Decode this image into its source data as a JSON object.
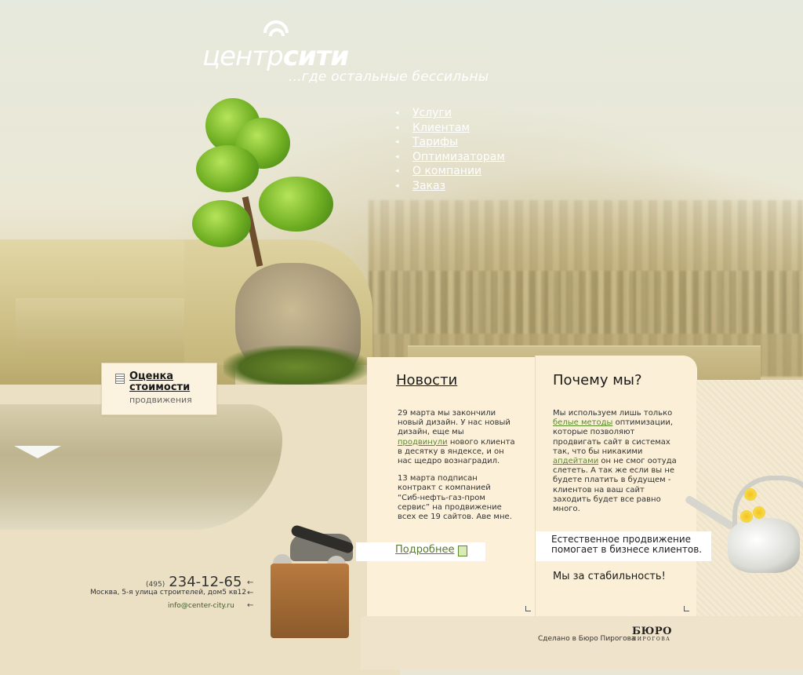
{
  "logo": {
    "part1": "центр",
    "part2": "сити",
    "tagline": "...где остальные бессильны"
  },
  "menu": [
    {
      "label": "Услуги"
    },
    {
      "label": "Клиентам"
    },
    {
      "label": "Тарифы"
    },
    {
      "label": "Оптимизаторам"
    },
    {
      "label": "О компании"
    },
    {
      "label": "Заказ"
    }
  ],
  "estimate": {
    "title": "Оценка стоимости",
    "subtitle": "продвижения"
  },
  "news": {
    "title": "Новости",
    "item1_before": "29 марта мы закончили новый дизайн. У нас новый дизайн, еще мы ",
    "item1_link": "продвинули",
    "item1_after": " нового клиента в десятку в яндексе, и он нас щедро вознаградил.",
    "item2": "13 марта подписан контракт с компанией “Сиб-нефть-газ-пром сервис” на продвижение всех ее 19 сайтов. Аве мне.",
    "more": "Подробнее"
  },
  "why": {
    "title": "Почему мы?",
    "text_before": "Мы используем лишь только ",
    "link1": "белые методы",
    "text_mid1": " оптимизации, которые позволяют продвигать сайт в системах так, что бы никакими ",
    "link2": "апдейтами",
    "text_mid2": " он не смог оотуда слететь. А так же если вы не будете платить в будущем - клиентов на ваш сайт заходить будет все равно много.",
    "banner": "Естественное продвижение помогает в бизнесе клиентов.",
    "stability": "Мы за стабильность!"
  },
  "contact": {
    "phone_code": "(495)",
    "phone": "234-12-65",
    "address": "Москва, 5-я улица строителей, дом5 кв12",
    "email": "info@center-city.ru"
  },
  "footer": {
    "credit": "Сделано в Бюро Пирогова",
    "bureau_big": "БЮРО",
    "bureau_small": "ПИРОГОВА"
  }
}
